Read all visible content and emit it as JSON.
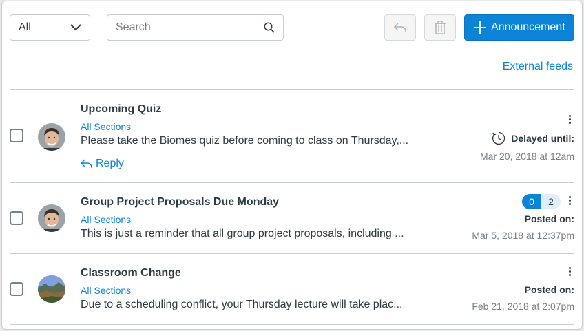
{
  "toolbar": {
    "filter": {
      "selected": "All"
    },
    "search": {
      "placeholder": "Search"
    },
    "announcement_button": "Announcement",
    "external_feeds": "External feeds"
  },
  "announcements": [
    {
      "title": "Upcoming Quiz",
      "sections": "All Sections",
      "snippet": "Please take the Biomes quiz before coming to class on Thursday,...",
      "reply": "Reply",
      "status_label": "Delayed until:",
      "date": "Mar 20, 2018 at 12am",
      "avatar": "man-face"
    },
    {
      "title": "Group Project Proposals Due Monday",
      "sections": "All Sections",
      "snippet": "This is just a reminder that all group project proposals, including ...",
      "unread_count": "0",
      "reply_count": "2",
      "status_label": "Posted on:",
      "date": "Mar 5, 2018 at 12:37pm",
      "avatar": "man-face"
    },
    {
      "title": "Classroom Change",
      "sections": "All Sections",
      "snippet": "Due to a scheduling conflict, your Thursday lecture will take plac...",
      "status_label": "Posted on:",
      "date": "Feb 21, 2018 at 2:07pm",
      "avatar": "landscape"
    }
  ],
  "colors": {
    "accent": "#0b84d8",
    "text": "#2d3b45",
    "muted": "#73818c",
    "border": "#c7cdd1"
  }
}
